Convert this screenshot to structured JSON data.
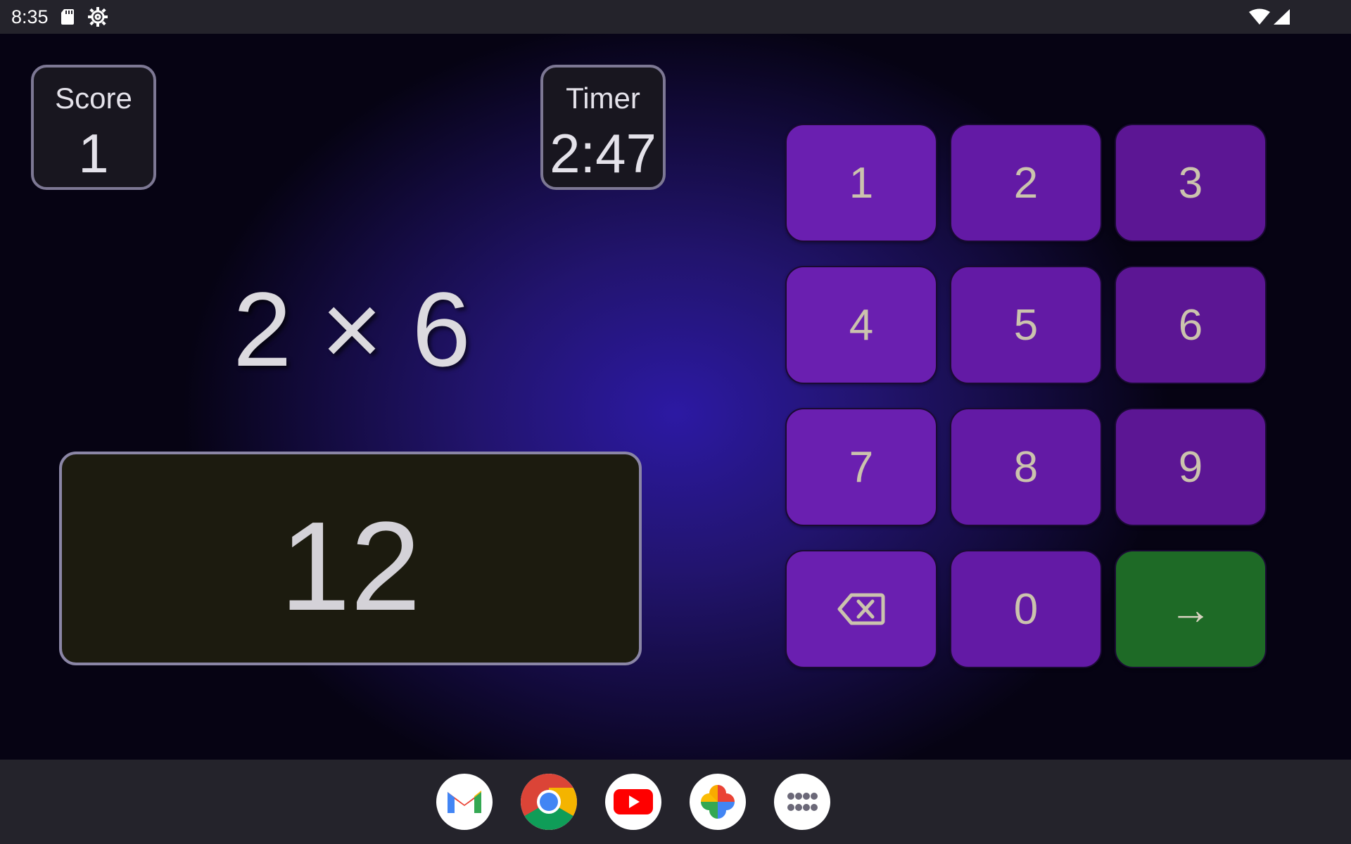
{
  "status_bar": {
    "time": "8:35",
    "icons": [
      "sd-card-icon",
      "settings-gear-icon",
      "wifi-icon",
      "cell-signal-icon"
    ]
  },
  "score": {
    "label": "Score",
    "value": "1"
  },
  "timer": {
    "label": "Timer",
    "value": "2:47"
  },
  "question": {
    "text": "2 × 6"
  },
  "answer": {
    "value": "12"
  },
  "keypad": {
    "keys": [
      "1",
      "2",
      "3",
      "4",
      "5",
      "6",
      "7",
      "8",
      "9",
      "⌫",
      "0",
      "→"
    ],
    "backspace_icon": "backspace-icon",
    "enter_label": "→"
  },
  "dock": {
    "apps": [
      "gmail-icon",
      "chrome-icon",
      "youtube-icon",
      "google-photos-icon",
      "app-drawer-icon"
    ]
  },
  "colors": {
    "key_purple": "#6a1fb0",
    "enter_green": "#1e6a26",
    "background_center": "#2c19a3",
    "answer_box": "#1c1b0f"
  }
}
